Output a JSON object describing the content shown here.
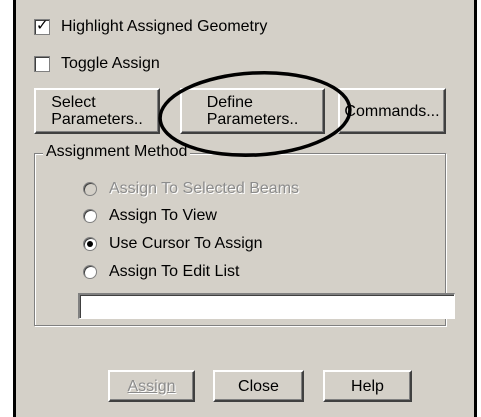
{
  "options": {
    "highlight": {
      "label": "Highlight Assigned Geometry",
      "checked": true
    },
    "toggle_assign": {
      "label": "Toggle Assign",
      "checked": false
    }
  },
  "buttons": {
    "select_parameters": "Select\nParameters..",
    "define_parameters": "Define\nParameters..",
    "commands": "Commands..."
  },
  "assignment_method": {
    "title": "Assignment Method",
    "options": [
      {
        "label": "Assign To Selected Beams",
        "selected": false,
        "disabled": true
      },
      {
        "label": "Assign To View",
        "selected": false,
        "disabled": false
      },
      {
        "label": "Use Cursor To Assign",
        "selected": true,
        "disabled": false
      },
      {
        "label": "Assign To Edit List",
        "selected": false,
        "disabled": false
      }
    ],
    "edit_list_value": ""
  },
  "footer": {
    "assign": "Assign",
    "close": "Close",
    "help": "Help"
  },
  "colors": {
    "dialog_bg": "#d4d0c8",
    "disabled_text": "#8c8c8c",
    "annotation": "#000000"
  }
}
